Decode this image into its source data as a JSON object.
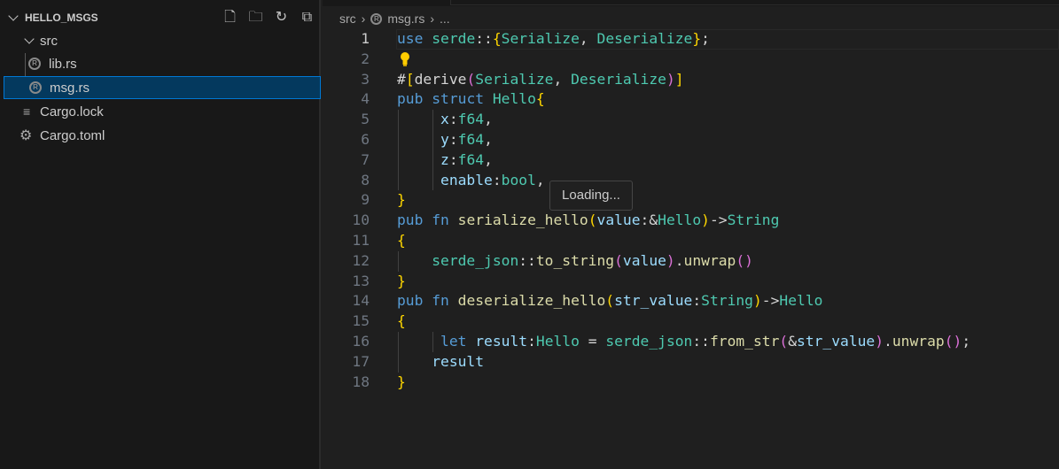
{
  "explorer": {
    "title": "HELLO_MSGS",
    "actions": [
      "new-file",
      "new-folder",
      "refresh",
      "collapse-all"
    ],
    "items": [
      {
        "label": "src",
        "type": "folder"
      },
      {
        "label": "lib.rs",
        "type": "rust"
      },
      {
        "label": "msg.rs",
        "type": "rust",
        "selected": true
      },
      {
        "label": "Cargo.lock",
        "type": "lock"
      },
      {
        "label": "Cargo.toml",
        "type": "toml"
      }
    ]
  },
  "breadcrumb": {
    "folder": "src",
    "file": "msg.rs",
    "more": "..."
  },
  "editor": {
    "current_line": 1,
    "lines": [
      [
        [
          "k",
          "use"
        ],
        [
          "p",
          " "
        ],
        [
          "t",
          "serde"
        ],
        [
          "p",
          "::"
        ],
        [
          "b1",
          "{"
        ],
        [
          "t",
          "Serialize"
        ],
        [
          "p",
          ", "
        ],
        [
          "t",
          "Deserialize"
        ],
        [
          "b1",
          "}"
        ],
        [
          "p",
          ";"
        ]
      ],
      [],
      [
        [
          "p",
          "#"
        ],
        [
          "b1",
          "["
        ],
        [
          "p",
          "derive"
        ],
        [
          "b2",
          "("
        ],
        [
          "t",
          "Serialize"
        ],
        [
          "p",
          ", "
        ],
        [
          "t",
          "Deserialize"
        ],
        [
          "b2",
          ")"
        ],
        [
          "b1",
          "]"
        ]
      ],
      [
        [
          "k",
          "pub"
        ],
        [
          "p",
          " "
        ],
        [
          "k",
          "struct"
        ],
        [
          "p",
          " "
        ],
        [
          "t",
          "Hello"
        ],
        [
          "b1",
          "{"
        ]
      ],
      [
        [
          "p",
          "     "
        ],
        [
          "v",
          "x"
        ],
        [
          "p",
          ":"
        ],
        [
          "t",
          "f64"
        ],
        [
          "p",
          ","
        ]
      ],
      [
        [
          "p",
          "     "
        ],
        [
          "v",
          "y"
        ],
        [
          "p",
          ":"
        ],
        [
          "t",
          "f64"
        ],
        [
          "p",
          ","
        ]
      ],
      [
        [
          "p",
          "     "
        ],
        [
          "v",
          "z"
        ],
        [
          "p",
          ":"
        ],
        [
          "t",
          "f64"
        ],
        [
          "p",
          ","
        ]
      ],
      [
        [
          "p",
          "     "
        ],
        [
          "v",
          "enable"
        ],
        [
          "p",
          ":"
        ],
        [
          "t",
          "bool"
        ],
        [
          "p",
          ","
        ]
      ],
      [
        [
          "b1",
          "}"
        ]
      ],
      [
        [
          "k",
          "pub"
        ],
        [
          "p",
          " "
        ],
        [
          "k",
          "fn"
        ],
        [
          "p",
          " "
        ],
        [
          "f",
          "serialize_hello"
        ],
        [
          "b1",
          "("
        ],
        [
          "v",
          "value"
        ],
        [
          "p",
          ":&"
        ],
        [
          "t",
          "Hello"
        ],
        [
          "b1",
          ")"
        ],
        [
          "p",
          "->"
        ],
        [
          "t",
          "String"
        ]
      ],
      [
        [
          "b1",
          "{"
        ]
      ],
      [
        [
          "p",
          "    "
        ],
        [
          "t",
          "serde_json"
        ],
        [
          "p",
          "::"
        ],
        [
          "f",
          "to_string"
        ],
        [
          "b2",
          "("
        ],
        [
          "v",
          "value"
        ],
        [
          "b2",
          ")"
        ],
        [
          "p",
          "."
        ],
        [
          "f",
          "unwrap"
        ],
        [
          "b2",
          "()"
        ]
      ],
      [
        [
          "b1",
          "}"
        ]
      ],
      [
        [
          "k",
          "pub"
        ],
        [
          "p",
          " "
        ],
        [
          "k",
          "fn"
        ],
        [
          "p",
          " "
        ],
        [
          "f",
          "deserialize_hello"
        ],
        [
          "b1",
          "("
        ],
        [
          "v",
          "str_value"
        ],
        [
          "p",
          ":"
        ],
        [
          "t",
          "String"
        ],
        [
          "b1",
          ")"
        ],
        [
          "p",
          "->"
        ],
        [
          "t",
          "Hello"
        ]
      ],
      [
        [
          "b1",
          "{"
        ]
      ],
      [
        [
          "p",
          "     "
        ],
        [
          "k",
          "let"
        ],
        [
          "p",
          " "
        ],
        [
          "v",
          "result"
        ],
        [
          "p",
          ":"
        ],
        [
          "t",
          "Hello"
        ],
        [
          "p",
          " = "
        ],
        [
          "t",
          "serde_json"
        ],
        [
          "p",
          "::"
        ],
        [
          "f",
          "from_str"
        ],
        [
          "b2",
          "("
        ],
        [
          "p",
          "&"
        ],
        [
          "v",
          "str_value"
        ],
        [
          "b2",
          ")"
        ],
        [
          "p",
          "."
        ],
        [
          "f",
          "unwrap"
        ],
        [
          "b2",
          "()"
        ],
        [
          "p",
          ";"
        ]
      ],
      [
        [
          "p",
          "    "
        ],
        [
          "v",
          "result"
        ]
      ],
      [
        [
          "b1",
          "}"
        ]
      ]
    ]
  },
  "tooltip": {
    "text": "Loading..."
  }
}
